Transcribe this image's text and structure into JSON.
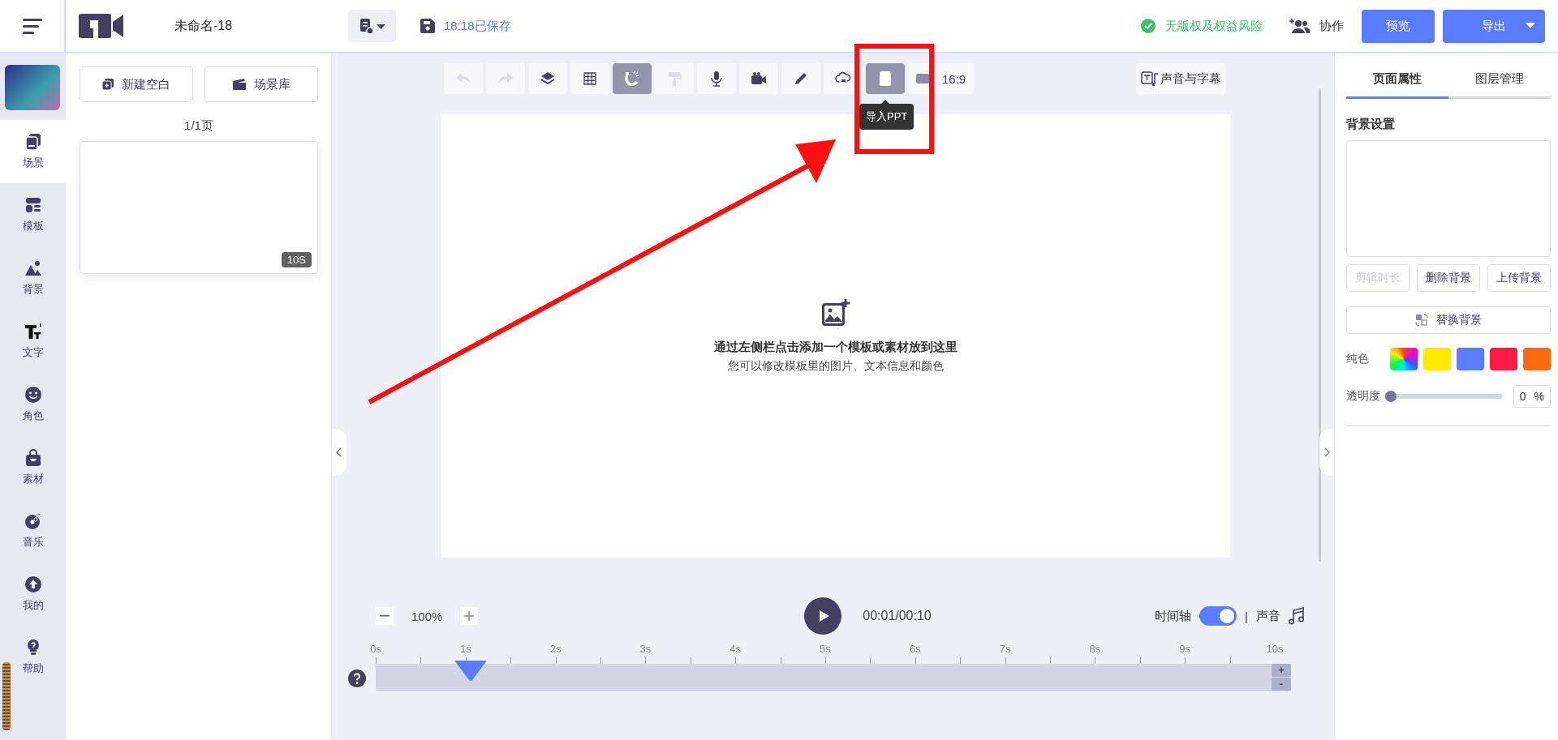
{
  "header": {
    "project_name": "未命名-18",
    "save_status": "18:18已保存",
    "copyright_status": "无版权及权益风险",
    "collaborate": "协作",
    "preview": "预览",
    "export": "导出"
  },
  "nav": [
    {
      "label": "场景",
      "selected": true
    },
    {
      "label": "模板",
      "selected": false
    },
    {
      "label": "背景",
      "selected": false
    },
    {
      "label": "文字",
      "selected": false
    },
    {
      "label": "角色",
      "selected": false
    },
    {
      "label": "素材",
      "selected": false
    },
    {
      "label": "音乐",
      "selected": false
    },
    {
      "label": "我的",
      "selected": false
    },
    {
      "label": "帮助",
      "selected": false
    }
  ],
  "scenes": {
    "new_blank": "新建空白",
    "library": "场景库",
    "page_count": "1/1页",
    "cards": [
      {
        "duration": "10S"
      }
    ]
  },
  "toolbar": {
    "tools": [
      {
        "selected": false,
        "disabled": true
      },
      {
        "selected": false,
        "disabled": true
      },
      {
        "selected": false,
        "disabled": false
      },
      {
        "selected": false,
        "disabled": false
      },
      {
        "selected": true,
        "disabled": false
      },
      {
        "selected": false,
        "disabled": true
      },
      {
        "selected": false,
        "disabled": false
      },
      {
        "selected": false,
        "disabled": false
      },
      {
        "selected": false,
        "disabled": false
      },
      {
        "selected": false,
        "disabled": false
      },
      {
        "selected": true,
        "disabled": false,
        "tooltip": "导入PPT"
      }
    ],
    "aspect_ratio": "16:9",
    "voice_subtitles": "声音与字幕"
  },
  "canvas": {
    "hint_title": "通过左侧栏点击添加一个模板或素材放到这里",
    "hint_text": "您可以修改模板里的图片、文本信息和颜色"
  },
  "playback": {
    "zoom": "100%",
    "time": "00:01/00:10",
    "timeline_label": "时间轴",
    "timeline_on": true,
    "separator": "|",
    "sound_label": "声音"
  },
  "timeline": {
    "ticks": [
      "0s",
      "1s",
      "2s",
      "3s",
      "4s",
      "5s",
      "6s",
      "7s",
      "8s",
      "9s",
      "10s"
    ],
    "level": 0.1,
    "zoom_in": "+",
    "zoom_out": "-"
  },
  "properties": {
    "tabs": [
      {
        "label": "页面属性",
        "selected": true
      },
      {
        "label": "图层管理",
        "selected": false
      }
    ],
    "section_title": "背景设置",
    "buttons": [
      {
        "label": "剪辑时长",
        "disabled": true
      },
      {
        "label": "删除背景",
        "disabled": false
      },
      {
        "label": "上传背景",
        "disabled": false
      }
    ],
    "replace": "替换背景",
    "solid_label": "纯色",
    "swatches": [
      {
        "kind": "spectrum"
      },
      {
        "kind": "solid",
        "color": "#ffea00"
      },
      {
        "kind": "solid",
        "color": "#5a7cff"
      },
      {
        "kind": "solid",
        "color": "#ff1b45"
      },
      {
        "kind": "solid",
        "color": "#ff6b12"
      }
    ],
    "opacity_label": "透明度",
    "opacity": {
      "level": 0
    },
    "opacity_value": "0",
    "opacity_unit": "%"
  }
}
